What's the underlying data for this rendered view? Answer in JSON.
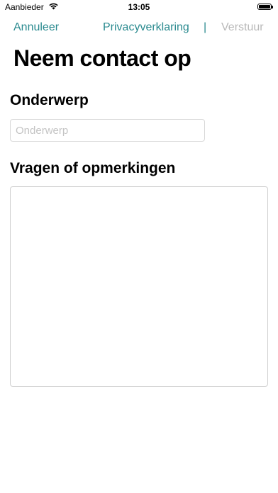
{
  "status_bar": {
    "carrier": "Aanbieder",
    "time": "13:05",
    "wifi_icon": "wifi-icon",
    "battery_icon": "battery-icon",
    "battery_level": 1.0
  },
  "nav": {
    "cancel_label": "Annuleer",
    "privacy_label": "Privacyverklaring",
    "separator": "|",
    "send_label": "Verstuur"
  },
  "page": {
    "title": "Neem contact op"
  },
  "form": {
    "subject": {
      "label": "Onderwerp",
      "placeholder": "Onderwerp",
      "value": ""
    },
    "remarks": {
      "label": "Vragen of opmerkingen",
      "value": ""
    }
  },
  "colors": {
    "accent": "#2a8a8f",
    "disabled": "#b9b9b9"
  }
}
